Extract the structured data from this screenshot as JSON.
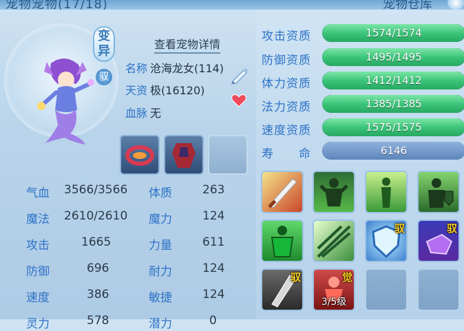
{
  "header": {
    "left_title": "宠物宠物(17/18)",
    "right_title": "宠物仓库"
  },
  "pet": {
    "mutation_badge": "变异",
    "tame_badge": "驭",
    "details_link": "查看宠物详情",
    "name_label": "名称",
    "name_value": "沧海龙女(114)",
    "talent_label": "天资",
    "talent_value": "极(16120)",
    "bloodline_label": "血脉",
    "bloodline_value": "无"
  },
  "equipment": [
    {
      "name": "pet-equip-ring",
      "empty": false
    },
    {
      "name": "pet-equip-armor",
      "empty": false
    },
    {
      "name": "pet-equip-slot-empty",
      "empty": true
    }
  ],
  "stats": [
    {
      "label": "气血",
      "value": "3566/3566"
    },
    {
      "label": "体质",
      "value": "263"
    },
    {
      "label": "魔法",
      "value": "2610/2610"
    },
    {
      "label": "魔力",
      "value": "124"
    },
    {
      "label": "攻击",
      "value": "1665"
    },
    {
      "label": "力量",
      "value": "611"
    },
    {
      "label": "防御",
      "value": "696"
    },
    {
      "label": "耐力",
      "value": "124"
    },
    {
      "label": "速度",
      "value": "386"
    },
    {
      "label": "敏捷",
      "value": "124"
    },
    {
      "label": "灵力",
      "value": "578"
    },
    {
      "label": "潜力",
      "value": "0"
    }
  ],
  "aptitudes": [
    {
      "label": "攻击资质",
      "text": "1574/1574",
      "fill": 1.0,
      "color": "green"
    },
    {
      "label": "防御资质",
      "text": "1495/1495",
      "fill": 1.0,
      "color": "green"
    },
    {
      "label": "体力资质",
      "text": "1412/1412",
      "fill": 1.0,
      "color": "green"
    },
    {
      "label": "法力资质",
      "text": "1385/1385",
      "fill": 1.0,
      "color": "green"
    },
    {
      "label": "速度资质",
      "text": "1575/1575",
      "fill": 1.0,
      "color": "green"
    },
    {
      "label": "寿　　命",
      "text": "6146",
      "fill": 1.0,
      "color": "blue"
    }
  ],
  "skills": [
    {
      "icon": "sword-strike-icon",
      "tag": "",
      "level": ""
    },
    {
      "icon": "warrior-rage-icon",
      "tag": "",
      "level": ""
    },
    {
      "icon": "figure-light-icon",
      "tag": "",
      "level": ""
    },
    {
      "icon": "knight-shield-icon",
      "tag": "",
      "level": ""
    },
    {
      "icon": "green-strength-icon",
      "tag": "",
      "level": ""
    },
    {
      "icon": "light-burst-icon",
      "tag": "",
      "level": ""
    },
    {
      "icon": "shield-guard-icon",
      "tag": "驭",
      "level": ""
    },
    {
      "icon": "purple-fist-icon",
      "tag": "驭",
      "level": ""
    },
    {
      "icon": "silver-blade-icon",
      "tag": "驭",
      "level": ""
    },
    {
      "icon": "awaken-demon-icon",
      "tag": "觉",
      "level": "3/5级"
    },
    {
      "icon": "empty-slot",
      "tag": "",
      "level": ""
    },
    {
      "icon": "empty-slot",
      "tag": "",
      "level": ""
    }
  ],
  "colors": {
    "label_blue": "#2e73c7",
    "bar_green": "#3cc57a",
    "bar_dark": "#2e4a63",
    "lifespan_blue": "#7a9fcd"
  }
}
